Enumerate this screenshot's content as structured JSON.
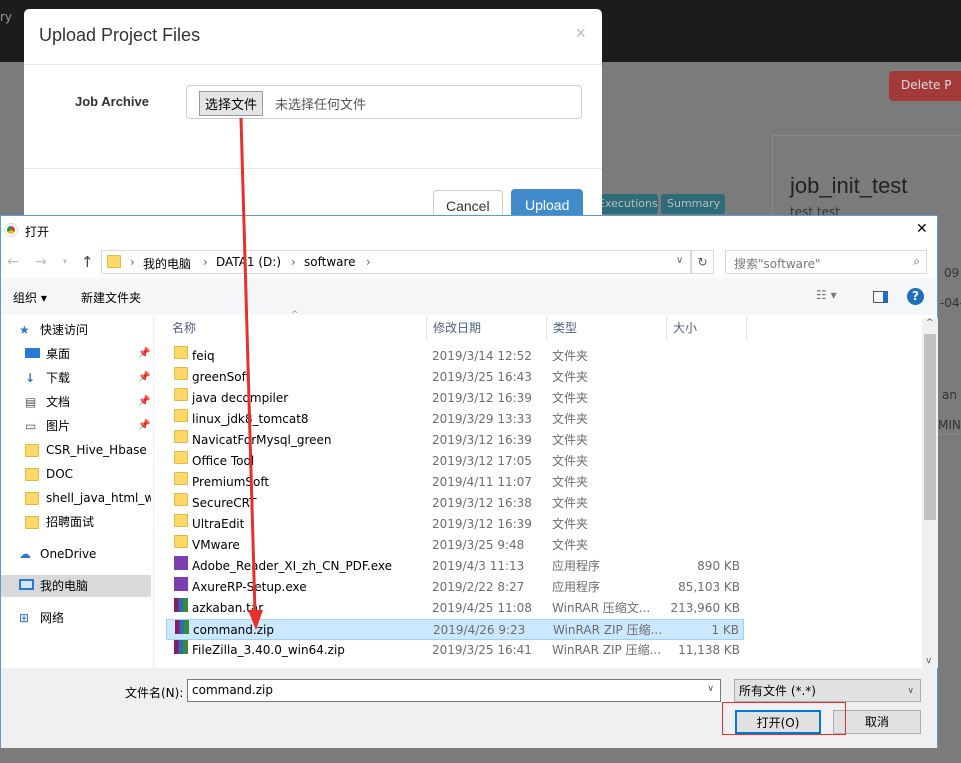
{
  "background": {
    "nav_text": "ry",
    "delete_button": "Delete P",
    "project_title": "job_init_test",
    "project_desc": "test test",
    "tabs": [
      "Executions",
      "Summary"
    ],
    "right_fragments": [
      "09",
      "-04-",
      "an",
      "MIN"
    ]
  },
  "upload_modal": {
    "title": "Upload Project Files",
    "close": "×",
    "label": "Job Archive",
    "choose_button": "选择文件",
    "no_file": "未选择任何文件",
    "cancel": "Cancel",
    "upload": "Upload"
  },
  "file_dialog": {
    "title": "打开",
    "close": "✕",
    "breadcrumb": [
      "我的电脑",
      "DATA1 (D:)",
      "software"
    ],
    "search_placeholder": "搜索\"software\"",
    "toolbar": {
      "organize": "组织 ▾",
      "new_folder": "新建文件夹"
    },
    "columns": [
      "名称",
      "修改日期",
      "类型",
      "大小"
    ],
    "nav": [
      {
        "label": "快速访问",
        "icon": "star-icon"
      },
      {
        "label": "桌面",
        "icon": "desktop-icon",
        "pinned": true
      },
      {
        "label": "下载",
        "icon": "download-icon",
        "pinned": true
      },
      {
        "label": "文档",
        "icon": "document-icon",
        "pinned": true
      },
      {
        "label": "图片",
        "icon": "picture-icon",
        "pinned": true
      },
      {
        "label": "CSR_Hive_Hbase",
        "icon": "folder-icon"
      },
      {
        "label": "DOC",
        "icon": "folder-icon"
      },
      {
        "label": "shell_java_html_wc",
        "icon": "folder-icon"
      },
      {
        "label": "招聘面试",
        "icon": "folder-icon"
      },
      {
        "label": "OneDrive",
        "icon": "cloud-icon"
      },
      {
        "label": "我的电脑",
        "icon": "computer-icon",
        "selected": true
      },
      {
        "label": "网络",
        "icon": "network-icon"
      }
    ],
    "files": [
      {
        "name": "feiq",
        "date": "2019/3/14 12:52",
        "type": "文件夹",
        "size": "",
        "icon": "folder"
      },
      {
        "name": "greenSoft",
        "date": "2019/3/25 16:43",
        "type": "文件夹",
        "size": "",
        "icon": "folder"
      },
      {
        "name": "java decompiler",
        "date": "2019/3/12 16:39",
        "type": "文件夹",
        "size": "",
        "icon": "folder"
      },
      {
        "name": "linux_jdk8_tomcat8",
        "date": "2019/3/29 13:33",
        "type": "文件夹",
        "size": "",
        "icon": "folder"
      },
      {
        "name": "NavicatForMysql_green",
        "date": "2019/3/12 16:39",
        "type": "文件夹",
        "size": "",
        "icon": "folder"
      },
      {
        "name": "Office Tool",
        "date": "2019/3/12 17:05",
        "type": "文件夹",
        "size": "",
        "icon": "folder"
      },
      {
        "name": "PremiumSoft",
        "date": "2019/4/11 11:07",
        "type": "文件夹",
        "size": "",
        "icon": "folder"
      },
      {
        "name": "SecureCRT",
        "date": "2019/3/12 16:38",
        "type": "文件夹",
        "size": "",
        "icon": "folder"
      },
      {
        "name": "UltraEdit",
        "date": "2019/3/12 16:39",
        "type": "文件夹",
        "size": "",
        "icon": "folder"
      },
      {
        "name": "VMware",
        "date": "2019/3/25 9:48",
        "type": "文件夹",
        "size": "",
        "icon": "folder"
      },
      {
        "name": "Adobe_Reader_XI_zh_CN_PDF.exe",
        "date": "2019/4/3 11:13",
        "type": "应用程序",
        "size": "890 KB",
        "icon": "exe"
      },
      {
        "name": "AxureRP-Setup.exe",
        "date": "2019/2/22 8:27",
        "type": "应用程序",
        "size": "85,103 KB",
        "icon": "exe"
      },
      {
        "name": "azkaban.tar",
        "date": "2019/4/25 11:08",
        "type": "WinRAR 压缩文...",
        "size": "213,960 KB",
        "icon": "rar"
      },
      {
        "name": "command.zip",
        "date": "2019/4/26 9:23",
        "type": "WinRAR ZIP 压缩...",
        "size": "1 KB",
        "icon": "rar",
        "selected": true
      },
      {
        "name": "FileZilla_3.40.0_win64.zip",
        "date": "2019/3/25 16:41",
        "type": "WinRAR ZIP 压缩...",
        "size": "11,138 KB",
        "icon": "rar"
      }
    ],
    "filename_label": "文件名(N):",
    "filename_value": "command.zip",
    "filter": "所有文件 (*.*)",
    "open": "打开(O)",
    "cancel": "取消"
  },
  "colors": {
    "annotation_red": "#e8302a",
    "selection": "#cce8ff",
    "upload_blue": "#428bca"
  }
}
